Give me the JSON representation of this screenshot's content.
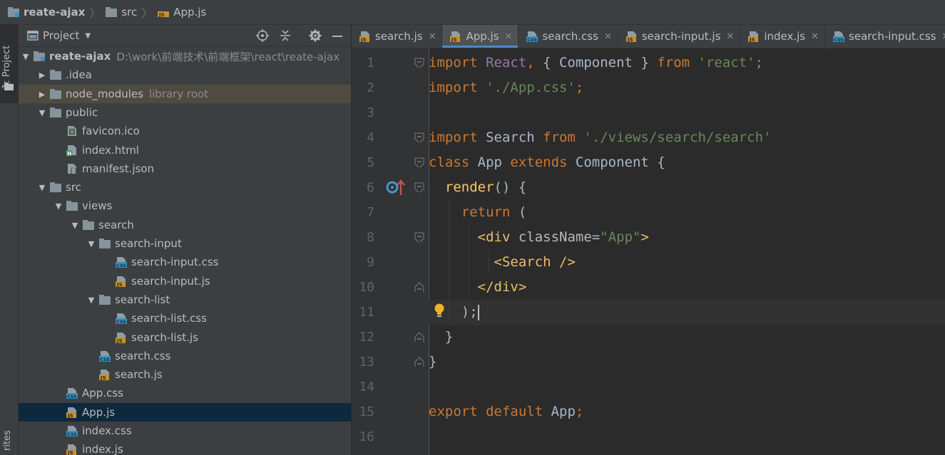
{
  "breadcrumb": {
    "project": "reate-ajax",
    "folder": "src",
    "file": "App.js"
  },
  "toolwindows": {
    "project_number": "1",
    "project_label": "Project",
    "favorites_label": "rites"
  },
  "panel": {
    "view_label": "Project"
  },
  "tree": [
    {
      "depth": 0,
      "arrow": "down",
      "icon": "folder-module",
      "name": "reate-ajax",
      "meta": "D:\\work\\前端技术\\前端框架\\react\\reate-ajax",
      "bold": true
    },
    {
      "depth": 1,
      "arrow": "right",
      "icon": "folder",
      "name": ".idea"
    },
    {
      "depth": 1,
      "arrow": "right",
      "icon": "folder",
      "name": "node_modules",
      "meta": "library root",
      "highlight": true
    },
    {
      "depth": 1,
      "arrow": "down",
      "icon": "folder",
      "name": "public"
    },
    {
      "depth": 2,
      "arrow": "",
      "icon": "ico",
      "name": "favicon.ico"
    },
    {
      "depth": 2,
      "arrow": "",
      "icon": "html",
      "name": "index.html"
    },
    {
      "depth": 2,
      "arrow": "",
      "icon": "json",
      "name": "manifest.json"
    },
    {
      "depth": 1,
      "arrow": "down",
      "icon": "folder",
      "name": "src"
    },
    {
      "depth": 2,
      "arrow": "down",
      "icon": "folder",
      "name": "views"
    },
    {
      "depth": 3,
      "arrow": "down",
      "icon": "folder",
      "name": "search"
    },
    {
      "depth": 4,
      "arrow": "down",
      "icon": "folder",
      "name": "search-input"
    },
    {
      "depth": 5,
      "arrow": "",
      "icon": "css",
      "name": "search-input.css"
    },
    {
      "depth": 5,
      "arrow": "",
      "icon": "js",
      "name": "search-input.js"
    },
    {
      "depth": 4,
      "arrow": "down",
      "icon": "folder",
      "name": "search-list"
    },
    {
      "depth": 5,
      "arrow": "",
      "icon": "css",
      "name": "search-list.css"
    },
    {
      "depth": 5,
      "arrow": "",
      "icon": "js",
      "name": "search-list.js"
    },
    {
      "depth": 4,
      "arrow": "",
      "icon": "css",
      "name": "search.css"
    },
    {
      "depth": 4,
      "arrow": "",
      "icon": "js",
      "name": "search.js"
    },
    {
      "depth": 2,
      "arrow": "",
      "icon": "css",
      "name": "App.css"
    },
    {
      "depth": 2,
      "arrow": "",
      "icon": "js",
      "name": "App.js",
      "selected": true
    },
    {
      "depth": 2,
      "arrow": "",
      "icon": "css",
      "name": "index.css"
    },
    {
      "depth": 2,
      "arrow": "",
      "icon": "js",
      "name": "index.js"
    }
  ],
  "tabs": [
    {
      "name": "search.js",
      "icon": "js"
    },
    {
      "name": "App.js",
      "icon": "js",
      "active": true
    },
    {
      "name": "search.css",
      "icon": "css"
    },
    {
      "name": "search-input.js",
      "icon": "js"
    },
    {
      "name": "index.js",
      "icon": "js"
    },
    {
      "name": "search-input.css",
      "icon": "css"
    }
  ],
  "editor": {
    "current_line": 11,
    "lines": [
      [
        [
          "kw",
          "import "
        ],
        [
          "imp",
          "React"
        ],
        [
          "kw",
          ", "
        ],
        [
          "t",
          "{ Component } "
        ],
        [
          "kw",
          "from "
        ],
        [
          "str",
          "'react'"
        ],
        [
          "kw",
          ";"
        ]
      ],
      [
        [
          "kw",
          "import "
        ],
        [
          "str",
          "'./App.css'"
        ],
        [
          "kw",
          ";"
        ]
      ],
      [],
      [
        [
          "kw",
          "import "
        ],
        [
          "t",
          "Search "
        ],
        [
          "kw",
          "from "
        ],
        [
          "str",
          "'./views/search/search'"
        ]
      ],
      [
        [
          "kw",
          "class "
        ],
        [
          "t",
          "App "
        ],
        [
          "kw",
          "extends "
        ],
        [
          "t",
          "Component {"
        ]
      ],
      [
        [
          "t",
          "  "
        ],
        [
          "fn",
          "render"
        ],
        [
          "t",
          "() {"
        ]
      ],
      [
        [
          "t",
          "    "
        ],
        [
          "kw",
          "return "
        ],
        [
          "t",
          "("
        ]
      ],
      [
        [
          "t",
          "      "
        ],
        [
          "tag",
          "<div "
        ],
        [
          "attr",
          "className"
        ],
        [
          "t",
          "="
        ],
        [
          "str",
          "\"App\""
        ],
        [
          "tag",
          ">"
        ]
      ],
      [
        [
          "t",
          "        "
        ],
        [
          "tag",
          "<Search />"
        ]
      ],
      [
        [
          "t",
          "      "
        ],
        [
          "tag",
          "</div>"
        ]
      ],
      [
        [
          "t",
          "    );"
        ]
      ],
      [
        [
          "t",
          "  }"
        ]
      ],
      [
        [
          "t",
          "}"
        ]
      ],
      [],
      [
        [
          "kw",
          "export default "
        ],
        [
          "t",
          "App"
        ],
        [
          "kw",
          ";"
        ]
      ],
      []
    ]
  }
}
